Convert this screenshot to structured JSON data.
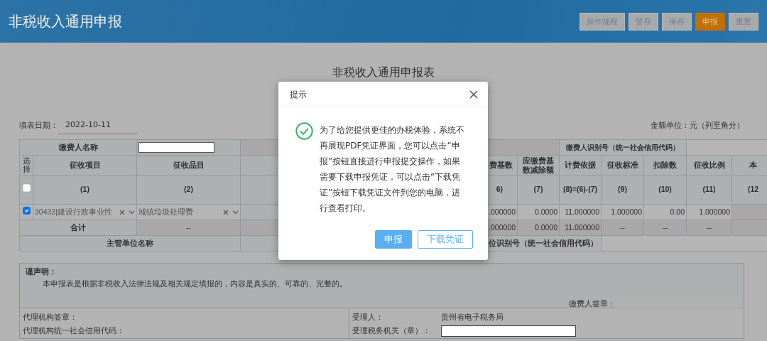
{
  "header": {
    "title": "非税收入通用申报",
    "buttons": [
      {
        "label": "操作规程",
        "kind": "default"
      },
      {
        "label": "暂存",
        "kind": "default"
      },
      {
        "label": "保存",
        "kind": "default"
      },
      {
        "label": "申报",
        "kind": "primary"
      },
      {
        "label": "重置",
        "kind": "default"
      }
    ]
  },
  "form": {
    "title": "非税收入通用申报表",
    "fill_date_label": "填表日期：",
    "fill_date": "2022-10-11",
    "amount_unit": "金额单位：元（列至角分）"
  },
  "table": {
    "payer_name_label": "缴费人名称",
    "payer_id_label": "缴费人识别号（统一社会信用代码）",
    "select_header": "选择",
    "header_checkbox": {
      "checked": false
    },
    "columns_left": [
      {
        "header": "征收项目",
        "number": "(1)"
      },
      {
        "header": "征收品目",
        "number": "(2)"
      }
    ],
    "columns_right": [
      {
        "header": "费基数",
        "number": "6)"
      },
      {
        "header": "应缴费基数减除额",
        "number": "(7)"
      },
      {
        "header": "计费依据",
        "number": "(8)=(6)-(7)"
      },
      {
        "header": "征收标准",
        "number": "(9)"
      },
      {
        "header": "扣除数",
        "number": "(10)"
      },
      {
        "header": "征收比例",
        "number": "(11)"
      },
      {
        "header": "本",
        "number": "(12"
      }
    ],
    "rows": [
      {
        "checked": true,
        "item": "30433|建设行政事业性",
        "category": "城镇垃圾处理费",
        "values": [
          ".000000",
          "0.0000",
          "11.000000",
          "1.000000",
          "0.00",
          "1.000000"
        ]
      }
    ],
    "total": {
      "label": "合计",
      "category": "--",
      "values": [
        ".000000",
        "0.0000",
        "11.000000",
        "--",
        "--",
        "--"
      ]
    },
    "supervisor": {
      "name_label": "主管单位名称",
      "id_label": "位识别号（统一社会信用代码）"
    }
  },
  "declaration": {
    "title": "谨声明：",
    "text": "本申报表是根据非税收入法律法规及相关规定填报的，内容是真实的、可靠的、完整的。",
    "signature_label": "缴费人签章："
  },
  "bottom": {
    "agent_seal_label": "代理机构签章：",
    "agent_code_label": "代理机构统一社会信用代码：",
    "receiver_label": "受理人：",
    "receiver_value": "贵州省电子税务局",
    "office_label": "受理税务机关（章）："
  },
  "dialog": {
    "title": "提示",
    "message": "为了给您提供更佳的办税体验，系统不再展现PDF凭证界面，您可以点击“申报”按钮直接进行申报提交操作，如果需要下载申报凭证，可以点击“下载凭证”按钮下载凭证文件到您的电脑，进行查看打印。",
    "buttons": [
      {
        "label": "申报",
        "kind": "primary"
      },
      {
        "label": "下载凭证",
        "kind": "outline"
      }
    ]
  }
}
